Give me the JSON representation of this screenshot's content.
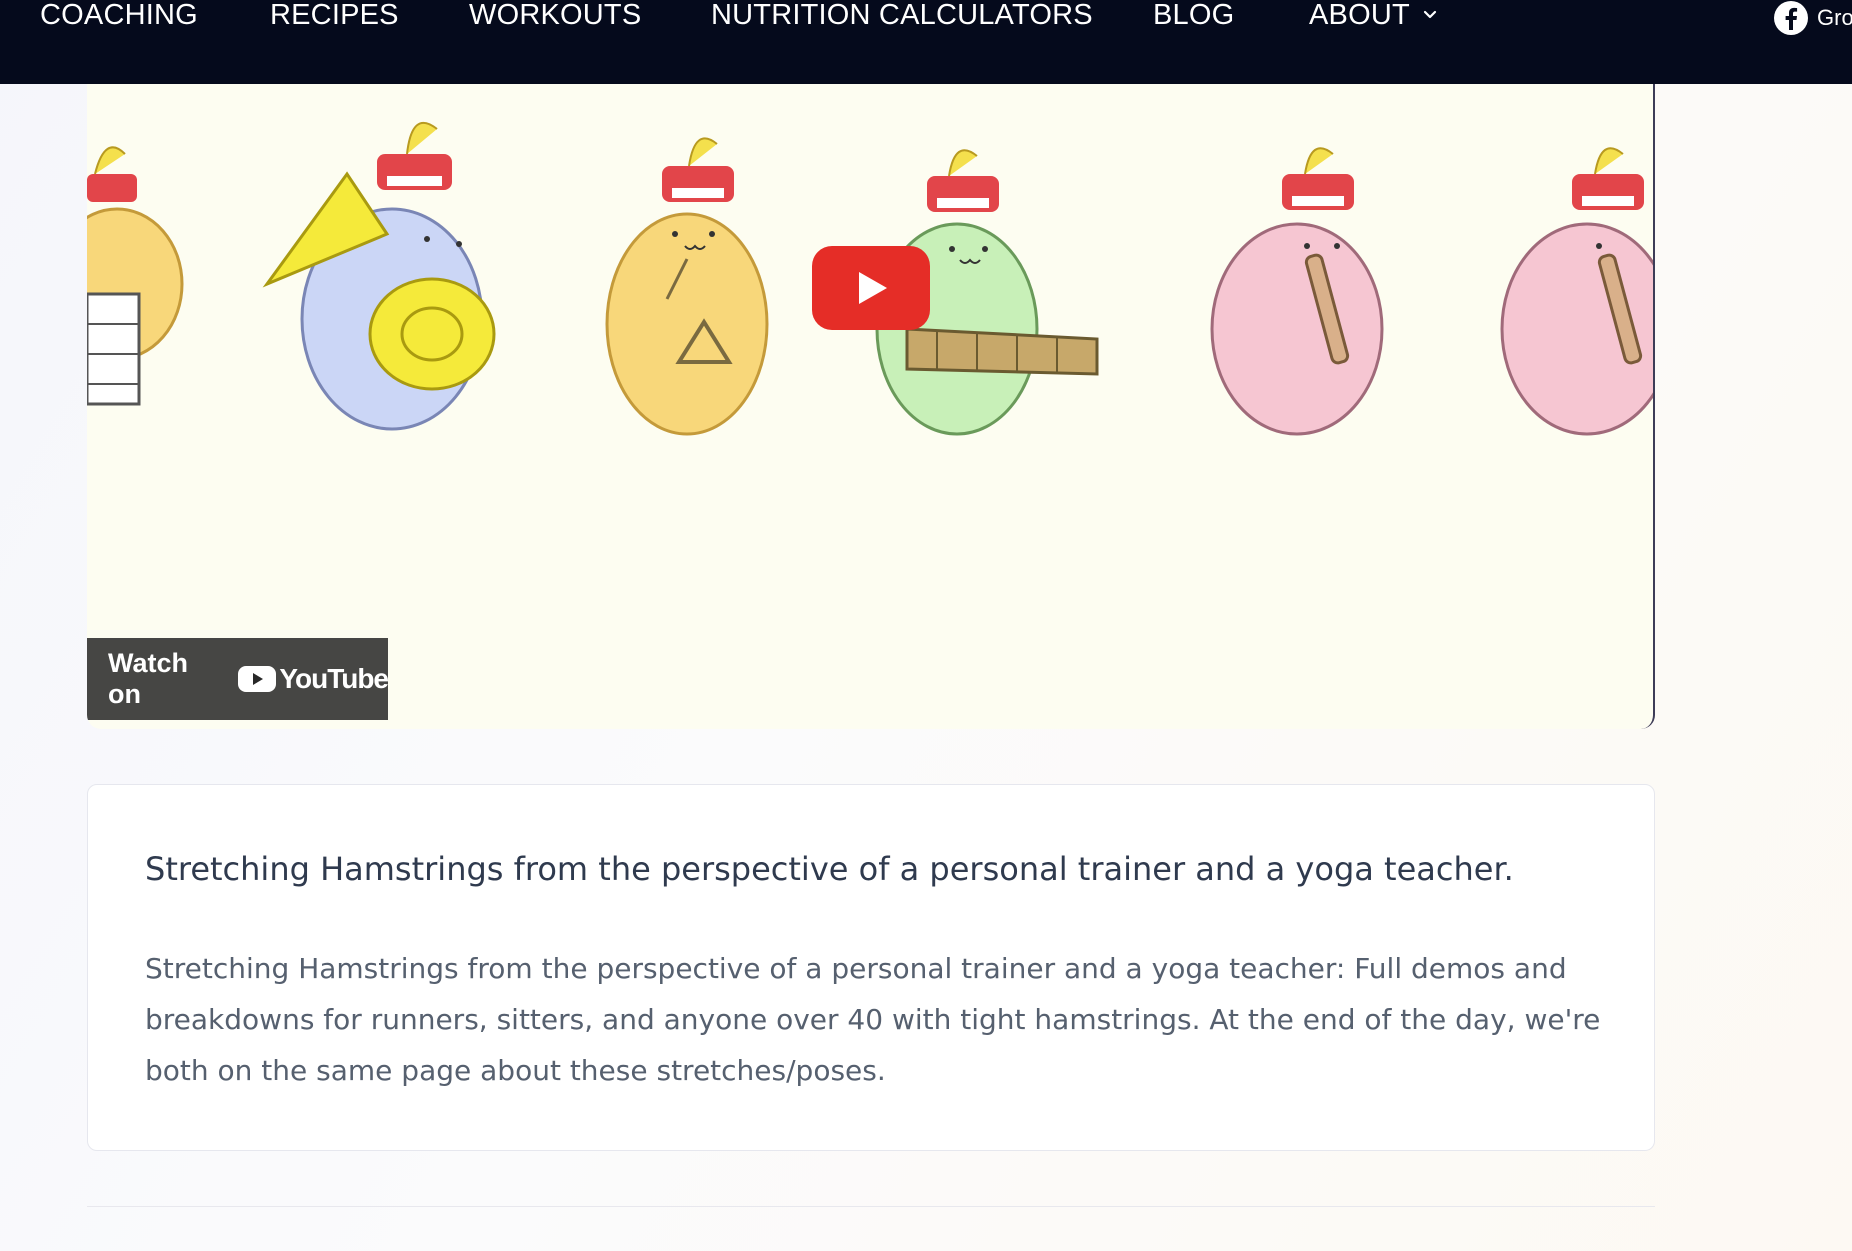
{
  "nav": {
    "items": [
      "COACHING",
      "RECIPES",
      "WORKOUTS",
      "NUTRITION CALCULATORS",
      "BLOG",
      "ABOUT"
    ],
    "social_label": "Gro"
  },
  "video": {
    "watch_on_label": "Watch on",
    "platform_label": "YouTube",
    "colors": {
      "play": "#e52d27",
      "background": "#fdfdf1"
    }
  },
  "card": {
    "title": "Stretching Hamstrings from the perspective of a personal trainer and a yoga teacher.",
    "description": "Stretching Hamstrings from the perspective of a personal trainer and a yoga teacher: Full demos and breakdowns for runners, sitters, and anyone over 40 with tight hamstrings. At the end of the day, we're both on the same page about these stretches/poses."
  },
  "icons": [
    "chevron-down-icon",
    "facebook-icon",
    "play-icon",
    "youtube-icon"
  ]
}
